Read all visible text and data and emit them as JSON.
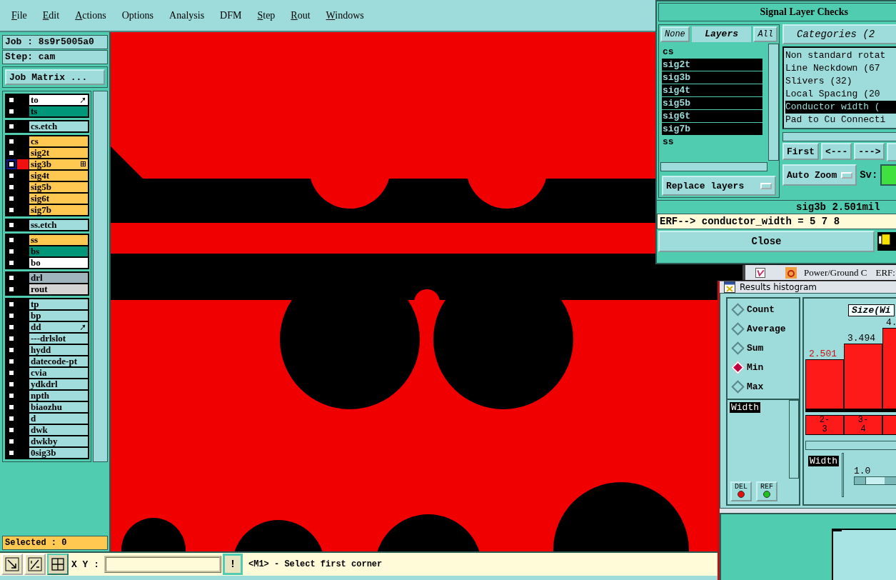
{
  "menu": [
    {
      "label": "File",
      "underlined": true
    },
    {
      "label": "Edit",
      "underlined": true
    },
    {
      "label": "Actions",
      "underlined": true
    },
    {
      "label": "Options",
      "underlined": false
    },
    {
      "label": "Analysis",
      "underlined": false
    },
    {
      "label": "DFM",
      "underlined": false
    },
    {
      "label": "Step",
      "underlined": true
    },
    {
      "label": "Rout",
      "underlined": true
    },
    {
      "label": "Windows",
      "underlined": true
    }
  ],
  "job": "Job : 8s9r5005a0",
  "step": "Step: cam",
  "job_matrix_button": "Job Matrix ...",
  "layer_groups": [
    [
      {
        "name": "to",
        "color": "#ffffff",
        "work": false,
        "flagged": true
      },
      {
        "name": "ts",
        "color": "#00967a",
        "work": false,
        "flagged": false
      }
    ],
    [
      {
        "name": "cs.etch",
        "color": "#a0dcdc",
        "work": false,
        "flagged": false
      }
    ],
    [
      {
        "name": "cs",
        "color": "#ffc850",
        "work": false,
        "flagged": false
      },
      {
        "name": "sig2t",
        "color": "#ffc850",
        "work": false,
        "flagged": false
      },
      {
        "name": "sig3b",
        "color": "#ffc850",
        "work": true,
        "flagged": false
      },
      {
        "name": "sig4t",
        "color": "#ffc850",
        "work": false,
        "flagged": false
      },
      {
        "name": "sig5b",
        "color": "#ffc850",
        "work": false,
        "flagged": false
      },
      {
        "name": "sig6t",
        "color": "#ffc850",
        "work": false,
        "flagged": false
      },
      {
        "name": "sig7b",
        "color": "#ffc850",
        "work": false,
        "flagged": false
      }
    ],
    [
      {
        "name": "ss.etch",
        "color": "#a0dcdc",
        "work": false,
        "flagged": false
      }
    ],
    [
      {
        "name": "ss",
        "color": "#ffc850",
        "work": false,
        "flagged": false
      },
      {
        "name": "bs",
        "color": "#00967a",
        "work": false,
        "flagged": false
      },
      {
        "name": "bo",
        "color": "#ffffff",
        "work": false,
        "flagged": false
      }
    ],
    [
      {
        "name": "drl",
        "color": "#9fb4bc",
        "work": false,
        "flagged": false
      },
      {
        "name": "rout",
        "color": "#d4d4d4",
        "work": false,
        "flagged": false
      }
    ],
    [
      {
        "name": "tp",
        "color": "#a0dcdc",
        "work": false,
        "flagged": false
      },
      {
        "name": "bp",
        "color": "#a0dcdc",
        "work": false,
        "flagged": false
      },
      {
        "name": "dd",
        "color": "#a0dcdc",
        "work": false,
        "flagged": true
      },
      {
        "name": "---drlslot",
        "color": "#a0dcdc",
        "work": false,
        "flagged": false
      },
      {
        "name": "hydd",
        "color": "#a0dcdc",
        "work": false,
        "flagged": false
      },
      {
        "name": "datecode-pt",
        "color": "#a0dcdc",
        "work": false,
        "flagged": false
      },
      {
        "name": "cvia",
        "color": "#a0dcdc",
        "work": false,
        "flagged": false
      },
      {
        "name": "ydkdrl",
        "color": "#a0dcdc",
        "work": false,
        "flagged": false
      },
      {
        "name": "npth",
        "color": "#a0dcdc",
        "work": false,
        "flagged": false
      },
      {
        "name": "biaozhu",
        "color": "#a0dcdc",
        "work": false,
        "flagged": false
      },
      {
        "name": "d",
        "color": "#a0dcdc",
        "work": false,
        "flagged": false
      },
      {
        "name": "dwk",
        "color": "#a0dcdc",
        "work": false,
        "flagged": false
      },
      {
        "name": "dwkby",
        "color": "#a0dcdc",
        "work": false,
        "flagged": false
      },
      {
        "name": "0sig3b",
        "color": "#a0dcdc",
        "work": false,
        "flagged": false
      }
    ]
  ],
  "selected_count": "Selected : 0",
  "bottom_bar": {
    "xy_label": "X Y :",
    "alert_button": "!",
    "message": "<M1> - Select first corner"
  },
  "signal_checks": {
    "title": "Signal Layer Checks",
    "none_button": "None",
    "layers_label": "Layers",
    "all_button": "All",
    "categories_button": "Categories (2",
    "layers": [
      {
        "name": "cs",
        "selected": false
      },
      {
        "name": "sig2t",
        "selected": true
      },
      {
        "name": "sig3b",
        "selected": true
      },
      {
        "name": "sig4t",
        "selected": true
      },
      {
        "name": "sig5b",
        "selected": true
      },
      {
        "name": "sig6t",
        "selected": true
      },
      {
        "name": "sig7b",
        "selected": true
      },
      {
        "name": "ss",
        "selected": false
      }
    ],
    "categories": [
      {
        "name": "Non standard rotat",
        "selected": false
      },
      {
        "name": "Line Neckdown (67",
        "selected": false
      },
      {
        "name": "Slivers (32)",
        "selected": false
      },
      {
        "name": "Local Spacing (20",
        "selected": false
      },
      {
        "name": "Conductor width (",
        "selected": true
      },
      {
        "name": "Pad to Cu Connecti",
        "selected": false
      }
    ],
    "nav_buttons": [
      "First",
      "<---",
      "--->"
    ],
    "auto_zoom": "Auto Zoom",
    "sv_label": "Sv:",
    "replace_layers": "Replace layers",
    "status": "sig3b 2.501mil",
    "erf_line": "ERF--> conductor_width = 5 7 8",
    "close_button": "Close"
  },
  "behind_window": {
    "checked": true,
    "title": "Power/Ground C",
    "field_label": "ERF:"
  },
  "histogram": {
    "title": "Results histogram",
    "modes": [
      {
        "label": "Count",
        "selected": false
      },
      {
        "label": "Average",
        "selected": false
      },
      {
        "label": "Sum",
        "selected": false
      },
      {
        "label": "Min",
        "selected": true
      },
      {
        "label": "Max",
        "selected": false
      }
    ],
    "attributes": [
      {
        "name": "Width",
        "selected": true
      }
    ],
    "del_button": "DEL",
    "ref_button": "REF",
    "chart_title": "Size(Wi",
    "bins": [
      {
        "value": "2.501",
        "is_min": true,
        "range_from": "2-",
        "range_to": "3"
      },
      {
        "value": "3.494",
        "is_min": false,
        "range_from": "3-",
        "range_to": "4"
      },
      {
        "value": "4.",
        "is_min": false
      }
    ],
    "lower_attributes": [
      {
        "name": "Width",
        "selected": true
      }
    ],
    "scale": {
      "value": "1.0",
      "level": 0.45
    }
  }
}
